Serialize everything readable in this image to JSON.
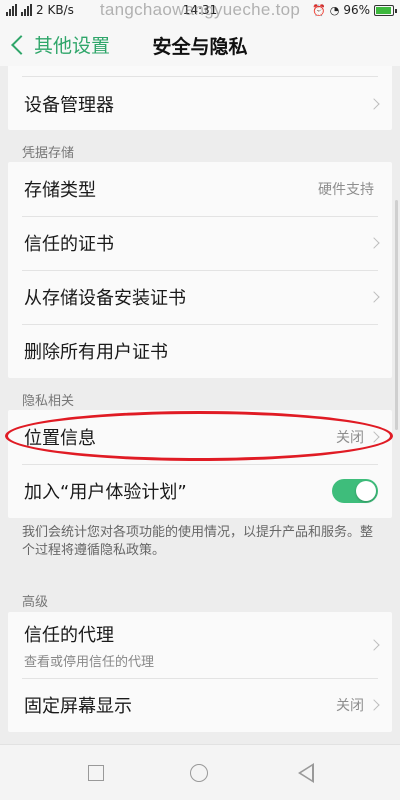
{
  "status_bar": {
    "network_speed": "2 KB/s",
    "time": "14:31",
    "battery": "96%"
  },
  "watermark": "tangchaowangyueche.top",
  "header": {
    "back_label": "其他设置",
    "title": "安全与隐私"
  },
  "sections": {
    "device_admin": {
      "label": "设备管理器"
    },
    "credential_storage": {
      "header": "凭据存储",
      "storage_type": {
        "label": "存储类型",
        "value": "硬件支持"
      },
      "trusted_certs": {
        "label": "信任的证书"
      },
      "install_from_storage": {
        "label": "从存储设备安装证书"
      },
      "remove_all_certs": {
        "label": "删除所有用户证书"
      }
    },
    "privacy": {
      "header": "隐私相关",
      "location": {
        "label": "位置信息",
        "value": "关闭"
      },
      "ux_plan": {
        "label": "加入“用户体验计划”",
        "enabled": true
      },
      "description": "我们会统计您对各项功能的使用情况，以提升产品和服务。整个过程将遵循隐私政策。"
    },
    "advanced": {
      "header": "高级",
      "trust_agents": {
        "label": "信任的代理",
        "sub": "查看或停用信任的代理"
      },
      "screen_pinning": {
        "label": "固定屏幕显示",
        "value": "关闭"
      }
    }
  },
  "colors": {
    "accent": "#2fa66a",
    "toggle_on": "#3ebd7b",
    "highlight": "#e01b24",
    "background": "#ededed"
  }
}
